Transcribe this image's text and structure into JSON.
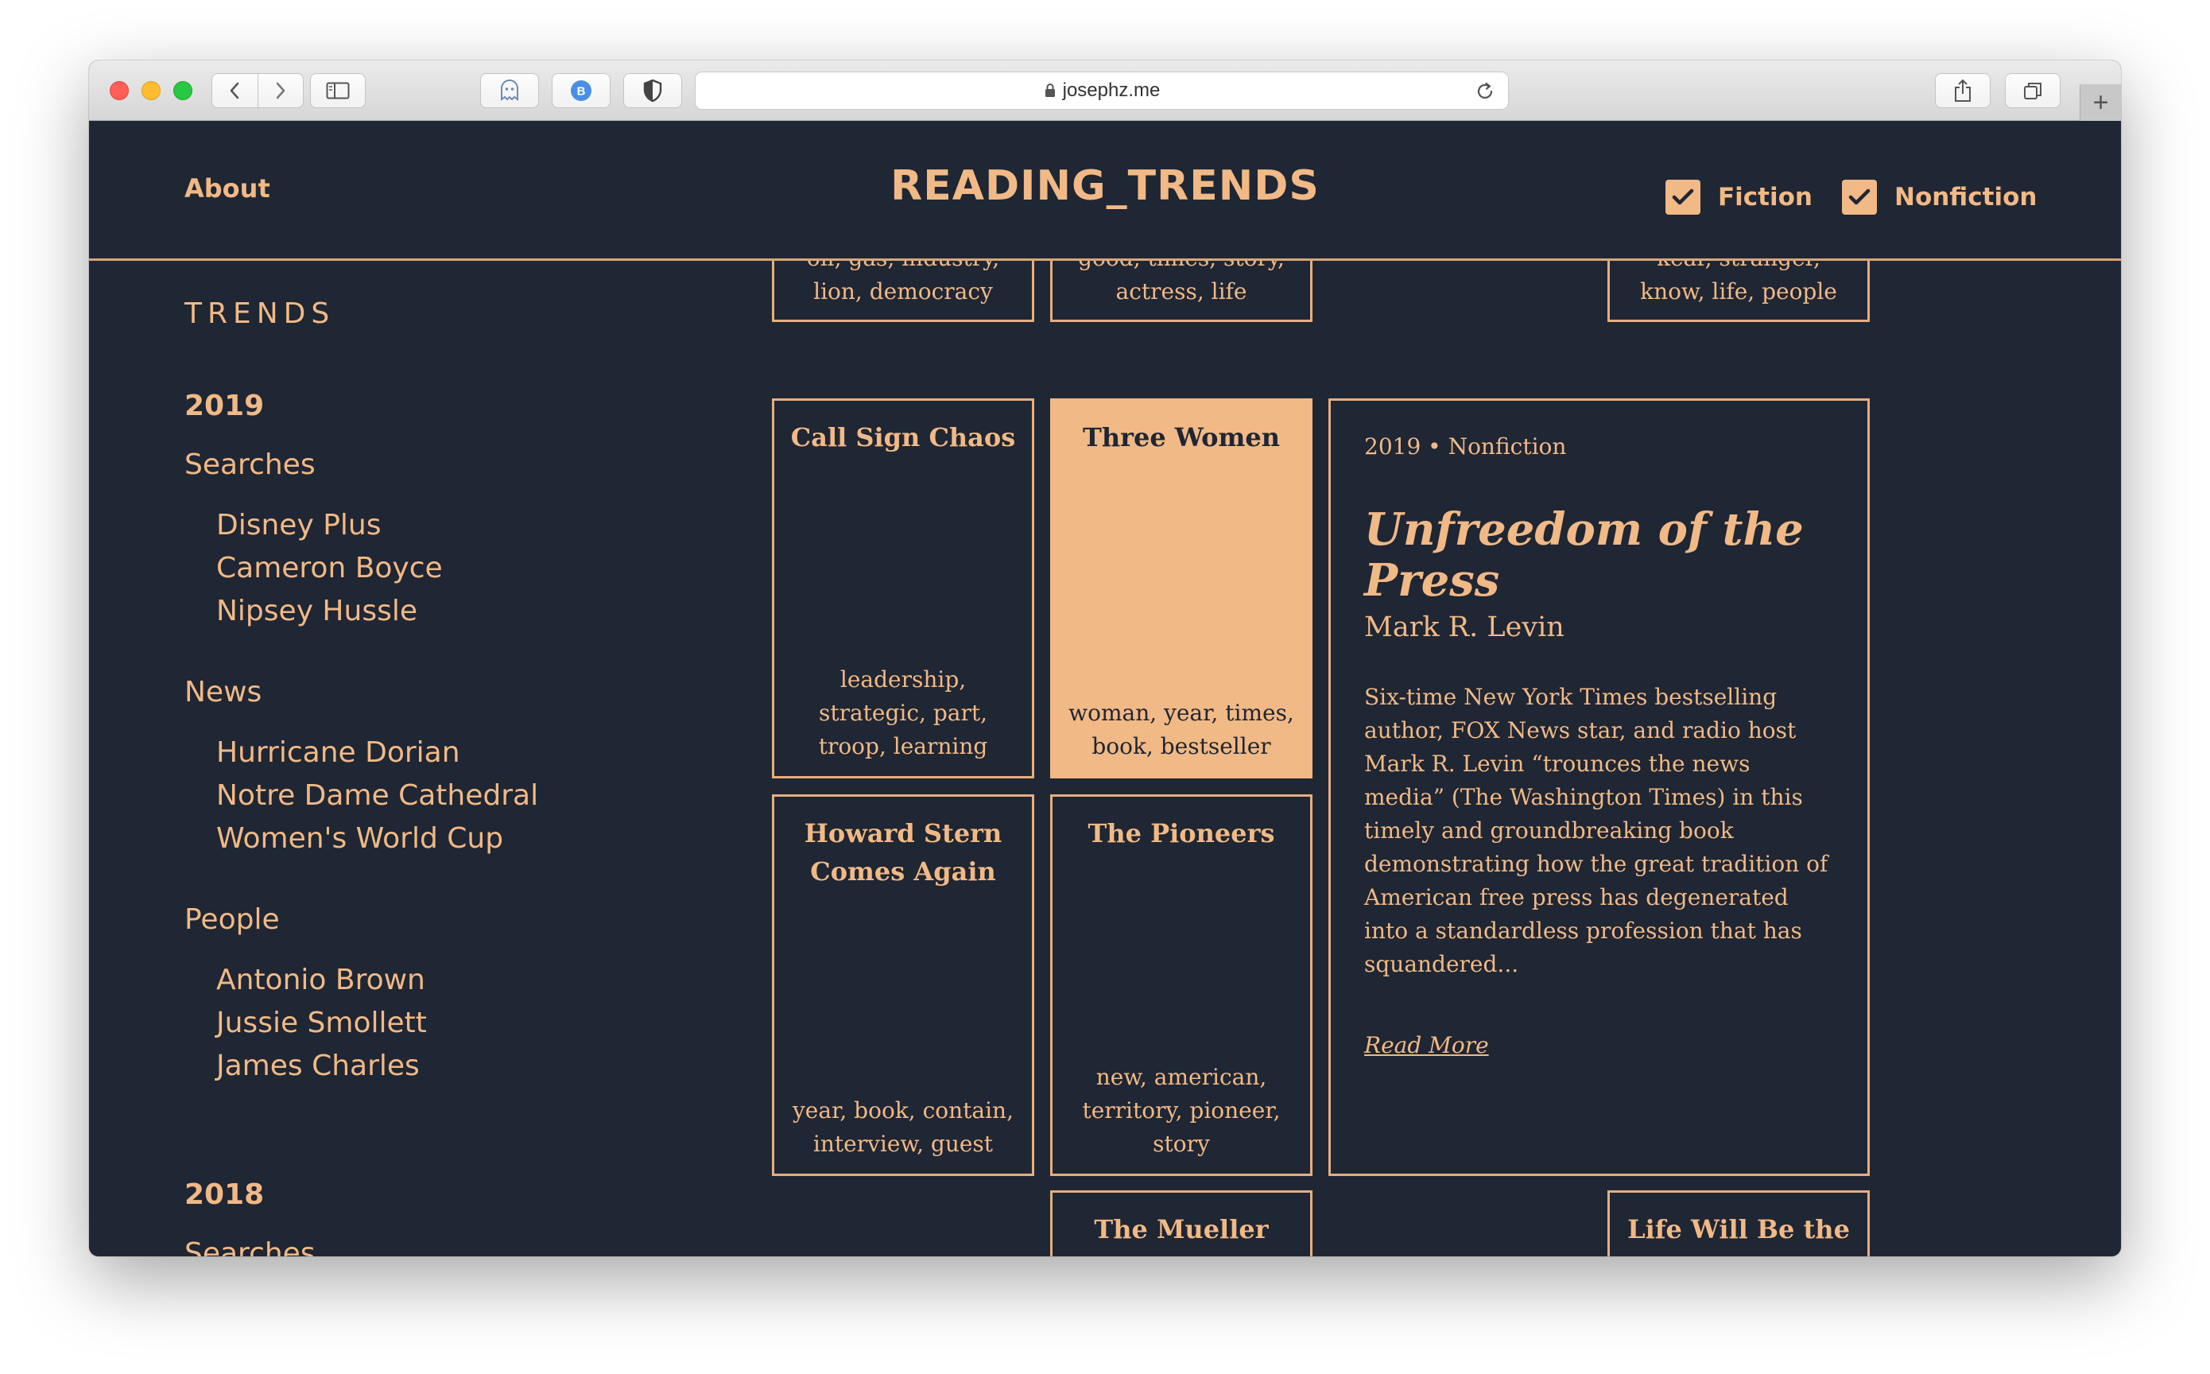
{
  "browser": {
    "url": "josephz.me",
    "new_tab_label": "+",
    "extensions": [
      {
        "icon": "ghost-icon"
      },
      {
        "icon": "bitwarden-icon",
        "label": "B"
      },
      {
        "icon": "shield-icon"
      }
    ]
  },
  "header": {
    "about": "About",
    "title": "READING_TRENDS",
    "filters": [
      {
        "label": "Fiction",
        "checked": true
      },
      {
        "label": "Nonfiction",
        "checked": true
      }
    ]
  },
  "sidebar": {
    "heading": "TRENDS",
    "years": [
      {
        "year": "2019",
        "sections": [
          {
            "label": "Searches",
            "items": [
              "Disney Plus",
              "Cameron Boyce",
              "Nipsey Hussle"
            ]
          },
          {
            "label": "News",
            "items": [
              "Hurricane Dorian",
              "Notre Dame Cathedral",
              "Women's World Cup"
            ]
          },
          {
            "label": "People",
            "items": [
              "Antonio Brown",
              "Jussie Smollett",
              "James Charles"
            ]
          }
        ]
      },
      {
        "year": "2018",
        "sections": [
          {
            "label": "Searches",
            "items": []
          }
        ]
      }
    ]
  },
  "grid": {
    "top_row": [
      {
        "keywords_line1": "oil, gas, industry,",
        "keywords_line2": "lion, democracy"
      },
      {
        "keywords_line1": "good, times, story,",
        "keywords_line2": "actress, life"
      },
      {
        "keywords_line1": "kear, stranger,",
        "keywords_line2": "know, life, people"
      }
    ],
    "tiles": [
      {
        "title": "Call Sign Chaos",
        "keywords": "leadership, strategic, part, troop, learning"
      },
      {
        "title": "Three Women",
        "keywords": "woman, year, times, book, bestseller"
      },
      {
        "title": "Howard Stern Comes Again",
        "keywords": "year, book, contain, interview, guest"
      },
      {
        "title": "The Pioneers",
        "keywords": "new, american, territory, pioneer, story"
      },
      {
        "title": "The Mueller Report",
        "keywords": ""
      },
      {
        "title": "Life Will Be the Death of Me",
        "keywords": ""
      }
    ]
  },
  "detail": {
    "meta": "2019 • Nonfiction",
    "title": "Unfreedom of the Press",
    "author": "Mark R. Levin",
    "description": "Six-time New York Times bestselling author, FOX News star, and radio host Mark R. Levin “trounces the news media” (The Washington Times) in this timely and groundbreaking book demonstrating how the great tradition of American free press has degenerated into a standardless profession that has squandered...",
    "read_more": "Read More"
  },
  "colors": {
    "background": "#1f2634",
    "accent": "#f1b985"
  }
}
